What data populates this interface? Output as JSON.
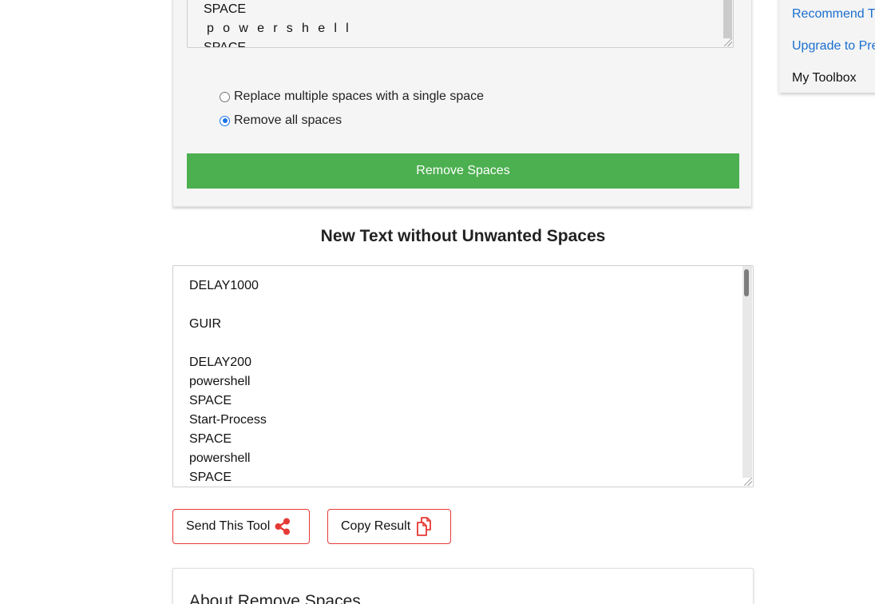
{
  "input": {
    "lines": [
      "SPACE",
      "p o w e r s h e l l",
      "SPACE"
    ]
  },
  "options": [
    {
      "label": "Replace multiple spaces with a single space",
      "checked": false
    },
    {
      "label": "Remove all spaces",
      "checked": true
    }
  ],
  "remove_button": {
    "label": "Remove Spaces",
    "color": "#4caf50"
  },
  "sidebar": {
    "items": [
      {
        "label": "Recommend This Tool",
        "type": "link"
      },
      {
        "label": "Upgrade to Premium",
        "type": "link"
      },
      {
        "label": "My Toolbox",
        "type": "plain"
      }
    ]
  },
  "output": {
    "title": "New Text without Unwanted Spaces",
    "lines": [
      "DELAY1000",
      "",
      "GUIR",
      "",
      "DELAY200",
      "powershell",
      "SPACE",
      "Start-Process",
      "SPACE",
      "powershell",
      "SPACE"
    ]
  },
  "actions": {
    "send_label": "Send This Tool",
    "send_icon": "share-icon",
    "copy_label": "Copy Result",
    "copy_icon": "copy-icon",
    "accent": "#e53935"
  },
  "about": {
    "title": "About Remove Spaces"
  }
}
